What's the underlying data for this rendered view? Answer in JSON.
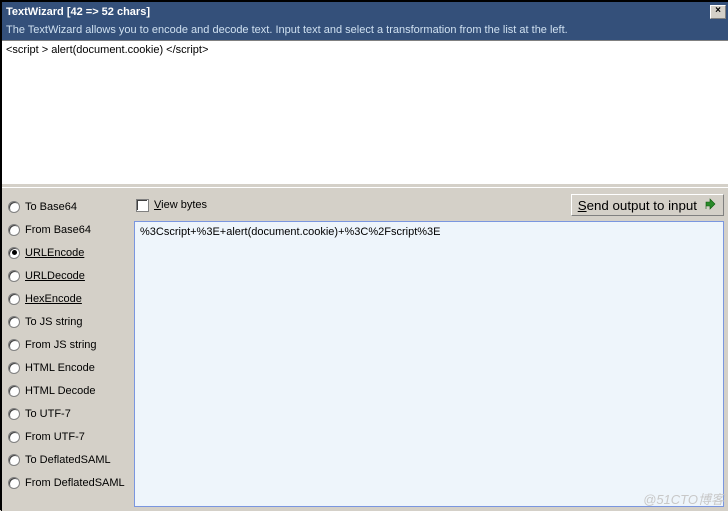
{
  "title": "TextWizard [42 => 52 chars]",
  "hint": "The TextWizard allows you to encode and decode text. Input text and select a transformation from the list at the left.",
  "input_text": "<script > alert(document.cookie) </script>",
  "view_bytes_label": "View bytes",
  "view_bytes_checked": false,
  "send_button_label": "Send output to input",
  "output_text": "%3Cscript+%3E+alert(document.cookie)+%3C%2Fscript%3E",
  "options": [
    {
      "label": "To Base64",
      "underline": false,
      "selected": false
    },
    {
      "label": "From Base64",
      "underline": false,
      "selected": false
    },
    {
      "label": "URLEncode",
      "underline": true,
      "selected": true
    },
    {
      "label": "URLDecode",
      "underline": true,
      "selected": false
    },
    {
      "label": "HexEncode",
      "underline": true,
      "selected": false
    },
    {
      "label": "To JS string",
      "underline": false,
      "selected": false
    },
    {
      "label": "From JS string",
      "underline": false,
      "selected": false
    },
    {
      "label": "HTML Encode",
      "underline": false,
      "selected": false
    },
    {
      "label": "HTML Decode",
      "underline": false,
      "selected": false
    },
    {
      "label": "To UTF-7",
      "underline": false,
      "selected": false
    },
    {
      "label": "From UTF-7",
      "underline": false,
      "selected": false
    },
    {
      "label": "To DeflatedSAML",
      "underline": false,
      "selected": false
    },
    {
      "label": "From DeflatedSAML",
      "underline": false,
      "selected": false
    }
  ],
  "watermark": "@51CTO博客"
}
